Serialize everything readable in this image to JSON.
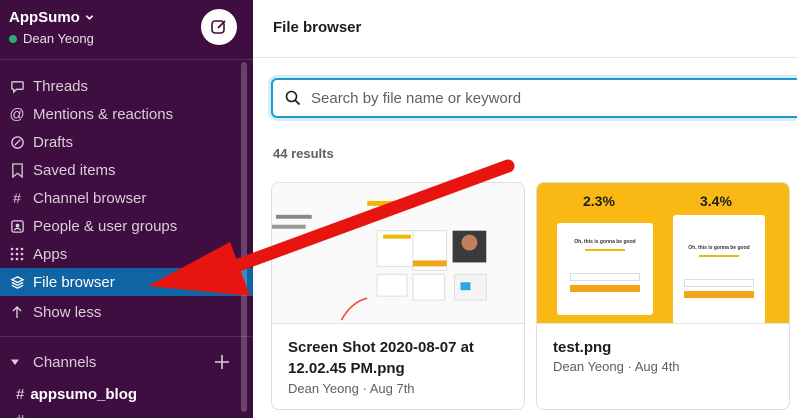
{
  "workspace": {
    "name": "AppSumo",
    "user": "Dean Yeong"
  },
  "sidebar": {
    "items": [
      {
        "label": "Threads",
        "icon": "threads-icon"
      },
      {
        "label": "Mentions & reactions",
        "icon": "at-icon"
      },
      {
        "label": "Drafts",
        "icon": "drafts-icon"
      },
      {
        "label": "Saved items",
        "icon": "bookmark-icon"
      },
      {
        "label": "Channel browser",
        "icon": "channel-browser-icon"
      },
      {
        "label": "People & user groups",
        "icon": "people-icon"
      },
      {
        "label": "Apps",
        "icon": "apps-grid-icon"
      },
      {
        "label": "File browser",
        "icon": "layers-icon",
        "active": true
      },
      {
        "label": "Show less",
        "icon": "arrow-up-icon"
      }
    ],
    "channels_label": "Channels",
    "channels": [
      "appsumo_blog",
      ""
    ]
  },
  "main": {
    "title": "File browser",
    "search_placeholder": "Search by file name or keyword",
    "results": "44 results",
    "files": [
      {
        "name": "Screen Shot 2020-08-07 at 12.02.45 PM.png",
        "author": "Dean Yeong",
        "date": "Aug 7th"
      },
      {
        "name": "test.png",
        "author": "Dean Yeong",
        "date": "Aug 4th"
      }
    ],
    "thumb2": {
      "left_pct": "2.3%",
      "right_pct": "3.4%",
      "card_text": "Oh, this is gonna be good"
    }
  },
  "colors": {
    "sidebar": "#3f0e40",
    "active": "#1164a3",
    "accent": "#1d9bd1",
    "annotation": "#e8140f"
  }
}
